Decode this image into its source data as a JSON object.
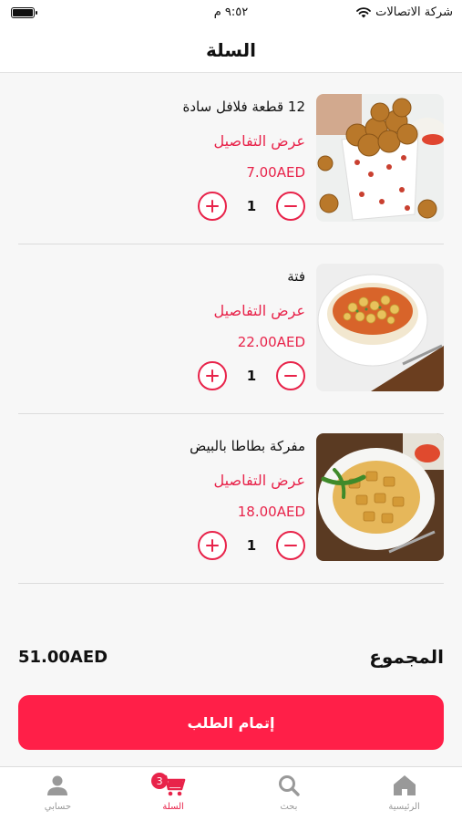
{
  "status_bar": {
    "carrier": "شركة الاتصالات",
    "time": "٩:٥٢ م"
  },
  "header": {
    "title": "السلة"
  },
  "cart": {
    "items": [
      {
        "name": "12 قطعة فلافل سادة",
        "details_label": "عرض التفاصيل",
        "price": "7.00AED",
        "quantity": "1",
        "image": "falafel-box"
      },
      {
        "name": "فتة",
        "details_label": "عرض التفاصيل",
        "price": "22.00AED",
        "quantity": "1",
        "image": "fatteh-bowl"
      },
      {
        "name": "مفركة بطاطا بالبيض",
        "details_label": "عرض التفاصيل",
        "price": "18.00AED",
        "quantity": "1",
        "image": "potato-egg-plate"
      }
    ]
  },
  "summary": {
    "total_label": "المجموع",
    "total_amount": "51.00AED",
    "checkout_label": "إتمام الطلب"
  },
  "tab_bar": {
    "tabs": [
      {
        "label": "حسابي",
        "icon": "person-icon",
        "active": false
      },
      {
        "label": "السلة",
        "icon": "cart-icon",
        "active": true,
        "badge": "3"
      },
      {
        "label": "بحث",
        "icon": "search-icon",
        "active": false
      },
      {
        "label": "الرئيسية",
        "icon": "home-icon",
        "active": false
      }
    ]
  },
  "colors": {
    "accent": "#e8234a",
    "checkout": "#ff1f48"
  }
}
